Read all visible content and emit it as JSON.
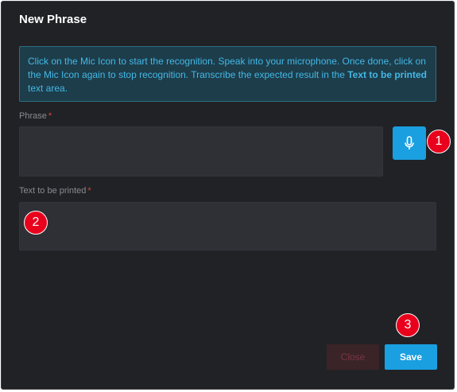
{
  "dialog": {
    "title": "New Phrase",
    "info": {
      "text_before": "Click on the Mic Icon to start the recognition. Speak into your microphone. Once done, click on the Mic Icon again to stop recognition. Transcribe the expected result in the ",
      "emphasis": "Text to be printed",
      "text_after": " text area."
    },
    "phrase": {
      "label": "Phrase",
      "required": "*",
      "value": ""
    },
    "printed": {
      "label": "Text to be printed",
      "required": "*",
      "value": ""
    },
    "buttons": {
      "close": "Close",
      "save": "Save"
    }
  },
  "annotations": [
    "1",
    "2",
    "3"
  ],
  "colors": {
    "accent": "#1a9fe0",
    "badge": "#e8001c",
    "background": "#212226"
  }
}
